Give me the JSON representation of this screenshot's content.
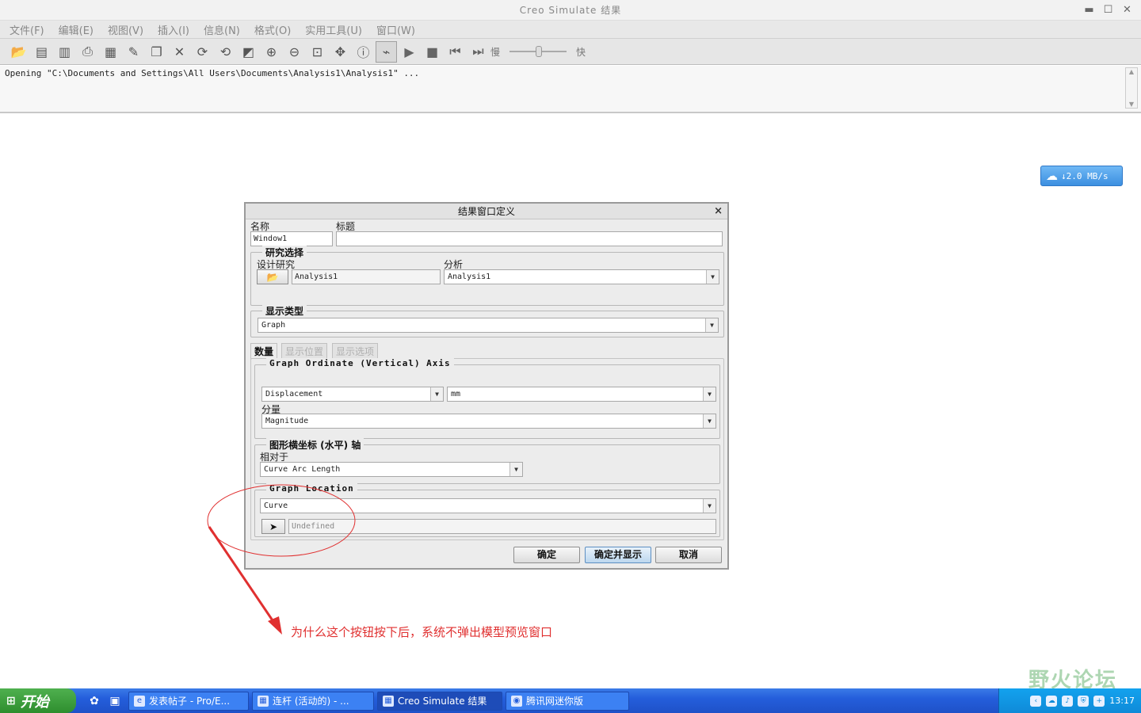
{
  "window": {
    "title": "Creo Simulate 结果",
    "controls": {
      "minimize": "▬",
      "maximize": "☐",
      "close": "✕"
    }
  },
  "menubar": [
    "文件(F)",
    "编辑(E)",
    "视图(V)",
    "插入(I)",
    "信息(N)",
    "格式(O)",
    "实用工具(U)",
    "窗口(W)"
  ],
  "toolbar": {
    "icons": [
      "open-icon",
      "save-icon",
      "save-copy-icon",
      "print-icon",
      "print-preview-icon",
      "edit-icon",
      "copy-icon",
      "delete-icon",
      "rotate-icon",
      "rotate2-icon",
      "repaint-icon",
      "zoom-in-icon",
      "zoom-out-icon",
      "refit-icon",
      "pan-icon",
      "info-icon",
      "curve-icon",
      "play-icon",
      "stop-icon",
      "first-frame-icon",
      "last-frame-icon"
    ],
    "slow_label": "慢",
    "fast_label": "快"
  },
  "message_area": {
    "text": "Opening \"C:\\Documents and Settings\\All Users\\Documents\\Analysis1\\Analysis1\" ..."
  },
  "speed_widget": {
    "text": "↓2.0 MB/s"
  },
  "dialog": {
    "title": "结果窗口定义",
    "close": "×",
    "name_label": "名称",
    "name_value": "Window1",
    "title_label": "标题",
    "title_value": "",
    "study_group": {
      "title": "研究选择",
      "design_study_label": "设计研究",
      "design_study_value": "Analysis1",
      "analysis_label": "分析",
      "analysis_value": "Analysis1"
    },
    "display_type": {
      "title": "显示类型",
      "value": "Graph"
    },
    "tabs": [
      "数量",
      "显示位置",
      "显示选项"
    ],
    "ordinate": {
      "title": "Graph Ordinate (Vertical) Axis",
      "quantity": "Displacement",
      "unit": "mm",
      "component_label": "分量",
      "component": "Magnitude"
    },
    "abscissa": {
      "title": "图形横坐标 (水平) 轴",
      "relative_label": "相对于",
      "relative_value": "Curve Arc Length"
    },
    "location": {
      "title": "Graph Location",
      "type": "Curve",
      "selection": "Undefined"
    },
    "buttons": {
      "ok": "确定",
      "ok_show": "确定并显示",
      "cancel": "取消"
    }
  },
  "annotation": {
    "text": "为什么这个按钮按下后，系统不弹出模型预览窗口",
    "color": "#e03030"
  },
  "watermark": {
    "text": "野火论坛"
  },
  "taskbar": {
    "start": "开始",
    "tasks": [
      "发表帖子 - Pro/E...",
      "连杆 (活动的) - ...",
      "Creo Simulate 结果",
      "腾讯网迷你版"
    ],
    "clock": "13:17"
  }
}
